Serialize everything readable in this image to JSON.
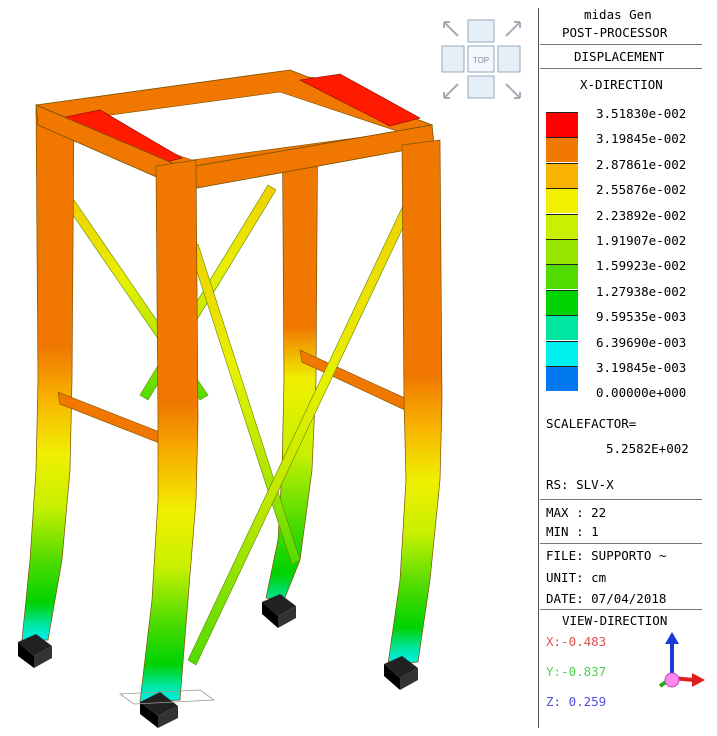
{
  "header": {
    "app": "midas Gen",
    "module": "POST-PROCESSOR",
    "result": "DISPLACEMENT",
    "component": "X-DIRECTION"
  },
  "legend": {
    "values": [
      "3.51830e-002",
      "3.19845e-002",
      "2.87861e-002",
      "2.55876e-002",
      "2.23892e-002",
      "1.91907e-002",
      "1.59923e-002",
      "1.27938e-002",
      "9.59535e-003",
      "6.39690e-003",
      "3.19845e-003",
      "0.00000e+000"
    ],
    "colors": [
      "#ff0000",
      "#f07800",
      "#f8b400",
      "#f0f000",
      "#c8f000",
      "#96e600",
      "#50dc00",
      "#00d200",
      "#00e6a0",
      "#00f0f0",
      "#0078f0"
    ]
  },
  "scale": {
    "label": "SCALEFACTOR=",
    "value": "5.2582E+002"
  },
  "rs": "RS: SLV-X",
  "maxmin": {
    "max": "MAX : 22",
    "min": "MIN : 1"
  },
  "info": {
    "file": "FILE: SUPPORTO ~",
    "unit": "UNIT: cm",
    "date": "DATE: 07/04/2018"
  },
  "view": {
    "title": "VIEW-DIRECTION",
    "x": "X:-0.483",
    "y": "Y:-0.837",
    "z": "Z: 0.259",
    "x_color": "#e05050",
    "y_color": "#50d050",
    "z_color": "#5050e0"
  },
  "nav_cube": {
    "center_label": "TOP"
  }
}
